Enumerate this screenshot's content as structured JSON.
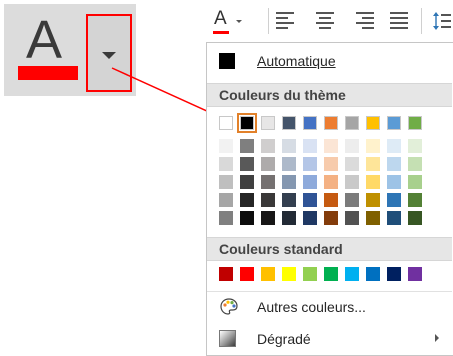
{
  "zoom": {
    "letter": "A",
    "accent_color": "#ff0000"
  },
  "toolbar": {
    "font_button_letter": "A",
    "icons": [
      "align-left-icon",
      "align-center-icon",
      "align-right-icon",
      "justify-icon",
      "line-spacing-icon"
    ]
  },
  "menu": {
    "automatic_label": "Automatique",
    "theme_colors_header": "Couleurs du thème",
    "standard_colors_header": "Couleurs standard",
    "more_colors_label": "Autres couleurs...",
    "gradient_label": "Dégradé",
    "theme_top_row": [
      "#ffffff",
      "#000000",
      "#e7e6e6",
      "#44546a",
      "#4472c4",
      "#ed7d31",
      "#a5a5a5",
      "#ffc000",
      "#5b9bd5",
      "#70ad47"
    ],
    "theme_shades": [
      [
        "#f2f2f2",
        "#d9d9d9",
        "#bfbfbf",
        "#a6a6a6",
        "#808080"
      ],
      [
        "#7f7f7f",
        "#595959",
        "#404040",
        "#262626",
        "#0d0d0d"
      ],
      [
        "#d0cece",
        "#aeabab",
        "#757171",
        "#3a3838",
        "#171616"
      ],
      [
        "#d6dce4",
        "#adb9ca",
        "#8497b0",
        "#333f4f",
        "#222a35"
      ],
      [
        "#d9e2f3",
        "#b4c6e7",
        "#8eaadb",
        "#2f5496",
        "#1f3864"
      ],
      [
        "#fbe5d5",
        "#f7cbac",
        "#f4b183",
        "#c55a11",
        "#833c0b"
      ],
      [
        "#ededed",
        "#dbdbdb",
        "#c9c9c9",
        "#7b7b7b",
        "#525252"
      ],
      [
        "#fff2cc",
        "#fee599",
        "#ffd966",
        "#bf9000",
        "#7f6000"
      ],
      [
        "#deebf6",
        "#bdd7ee",
        "#9dc3e6",
        "#2e75b5",
        "#1f4e79"
      ],
      [
        "#e2efd9",
        "#c5e0b3",
        "#a8d08d",
        "#538135",
        "#375623"
      ]
    ],
    "standard_colors": [
      "#c00000",
      "#ff0000",
      "#ffc000",
      "#ffff00",
      "#92d050",
      "#00b050",
      "#00b0f0",
      "#0070c0",
      "#002060",
      "#7030a0"
    ]
  }
}
